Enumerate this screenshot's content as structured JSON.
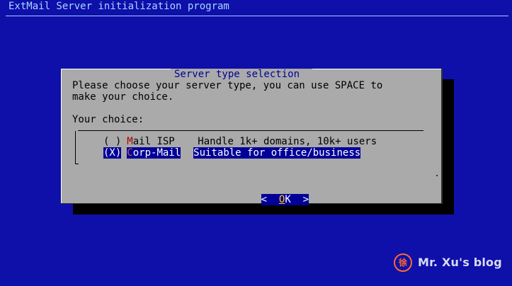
{
  "backtitle": "ExtMail Server initialization program",
  "dialog": {
    "title": "Server type selection",
    "prompt_line1": "Please choose your server type, you can use SPACE to",
    "prompt_line2": "make your choice.",
    "choice_label": "Your choice:",
    "options": [
      {
        "marker": "( )",
        "hotkey": "M",
        "name_rest": "ail ISP",
        "description": "Handle 1k+ domains, 10k+ users",
        "selected": false
      },
      {
        "marker": "(X)",
        "hotkey": "C",
        "name_rest": "orp-Mail",
        "description": "Suitable for office/business",
        "selected": true
      }
    ],
    "ok_button": {
      "left": "<",
      "hotkey": "O",
      "rest": "K",
      "right": ">"
    }
  },
  "watermark": {
    "logo_char": "徐",
    "text": "Mr. Xu's blog"
  },
  "colors": {
    "background": "#0f0faa",
    "dialog": "#aaaaaa",
    "selection": "#000099",
    "hotkey": "#aa0000",
    "watermark_logo": "#ff6a2a"
  }
}
